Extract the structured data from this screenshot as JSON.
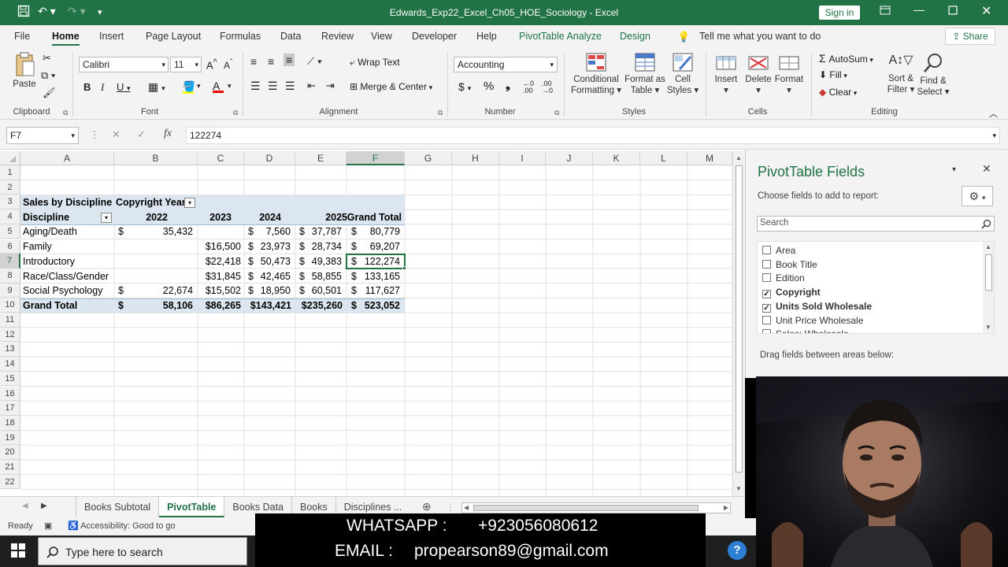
{
  "window": {
    "title": "Edwards_Exp22_Excel_Ch05_HOE_Sociology - Excel",
    "sign_in": "Sign in"
  },
  "ribbon_tabs": [
    "File",
    "Home",
    "Insert",
    "Page Layout",
    "Formulas",
    "Data",
    "Review",
    "View",
    "Developer",
    "Help",
    "PivotTable Analyze",
    "Design"
  ],
  "tell_me": "Tell me what you want to do",
  "share_label": "Share",
  "ribbon": {
    "paste": "Paste",
    "font_name": "Calibri",
    "font_size": "11",
    "wrap_text": "Wrap Text",
    "merge_center": "Merge & Center",
    "number_format": "Accounting",
    "conditional_formatting": [
      "Conditional",
      "Formatting"
    ],
    "format_as_table": [
      "Format as",
      "Table"
    ],
    "cell_styles": [
      "Cell",
      "Styles"
    ],
    "insert": "Insert",
    "delete": "Delete",
    "format": "Format",
    "autosum": "AutoSum",
    "fill": "Fill",
    "clear": "Clear",
    "sort_filter": [
      "Sort &",
      "Filter"
    ],
    "find_select": [
      "Find &",
      "Select"
    ],
    "groups": [
      "Clipboard",
      "Font",
      "Alignment",
      "Number",
      "Styles",
      "Cells",
      "Editing"
    ]
  },
  "formula_bar": {
    "name_box": "F7",
    "fx": "fx",
    "value": "122274"
  },
  "columns": [
    "A",
    "B",
    "C",
    "D",
    "E",
    "F",
    "G",
    "H",
    "I",
    "J",
    "K",
    "L",
    "M"
  ],
  "rows": [
    "1",
    "2",
    "3",
    "4",
    "5",
    "6",
    "7",
    "8",
    "9",
    "10",
    "11",
    "12",
    "13",
    "14",
    "15",
    "16",
    "17",
    "18",
    "19",
    "20",
    "21",
    "22"
  ],
  "pivot_table": {
    "title": "Sales by Discipline",
    "column_field": "Copyright Year",
    "row_field": "Discipline",
    "years": [
      "2022",
      "2023",
      "2024",
      "2025",
      "Grand Total"
    ],
    "rows": [
      {
        "label": "Aging/Death",
        "b_sym": "$",
        "b": "35,432",
        "c": "",
        "d_sym": "$",
        "d": "7,560",
        "e_sym": "$",
        "e": "37,787",
        "f_sym": "$",
        "f": "80,779"
      },
      {
        "label": "Family",
        "b_sym": "",
        "b": "",
        "c": "$16,500",
        "d_sym": "$",
        "d": "23,973",
        "e_sym": "$",
        "e": "28,734",
        "f_sym": "$",
        "f": "69,207"
      },
      {
        "label": "Introductory",
        "b_sym": "",
        "b": "",
        "c": "$22,418",
        "d_sym": "$",
        "d": "50,473",
        "e_sym": "$",
        "e": "49,383",
        "f_sym": "$",
        "f": "122,274"
      },
      {
        "label": "Race/Class/Gender",
        "b_sym": "",
        "b": "",
        "c": "$31,845",
        "d_sym": "$",
        "d": "42,465",
        "e_sym": "$",
        "e": "58,855",
        "f_sym": "$",
        "f": "133,165"
      },
      {
        "label": "Social Psychology",
        "b_sym": "$",
        "b": "22,674",
        "c": "$15,502",
        "d_sym": "$",
        "d": "18,950",
        "e_sym": "$",
        "e": "60,501",
        "f_sym": "$",
        "f": "117,627"
      }
    ],
    "grand_total": {
      "label": "Grand Total",
      "b_sym": "$",
      "b": "58,106",
      "c": "$86,265",
      "d": "$143,421",
      "e": "$235,260",
      "f_sym": "$",
      "f": "523,052"
    }
  },
  "sheet_tabs": [
    "Books Subtotal",
    "PivotTable",
    "Books Data",
    "Books",
    "Disciplines ..."
  ],
  "active_sheet": "PivotTable",
  "status": {
    "ready": "Ready",
    "accessibility": "Accessibility: Good to go"
  },
  "pivot_pane": {
    "title": "PivotTable Fields",
    "subtitle": "Choose fields to add to report:",
    "search_placeholder": "Search",
    "fields": [
      {
        "name": "Area",
        "checked": false
      },
      {
        "name": "Book Title",
        "checked": false
      },
      {
        "name": "Edition",
        "checked": false
      },
      {
        "name": "Copyright",
        "checked": true
      },
      {
        "name": "Units Sold Wholesale",
        "checked": true
      },
      {
        "name": "Unit Price Wholesale",
        "checked": false
      },
      {
        "name": "Sales: Wholesale",
        "checked": false
      }
    ],
    "drag_hint": "Drag fields between areas below:"
  },
  "taskbar": {
    "search_placeholder": "Type here to search"
  },
  "overlay": {
    "whatsapp_label": "WHATSAPP :",
    "whatsapp_value": "+923056080612",
    "email_label": "EMAIL :",
    "email_value": "propearson89@gmail.com"
  },
  "colors": {
    "excel_green": "#217346",
    "pivot_header": "#dce6f1",
    "ribbon_bg": "#f3f3f3"
  }
}
